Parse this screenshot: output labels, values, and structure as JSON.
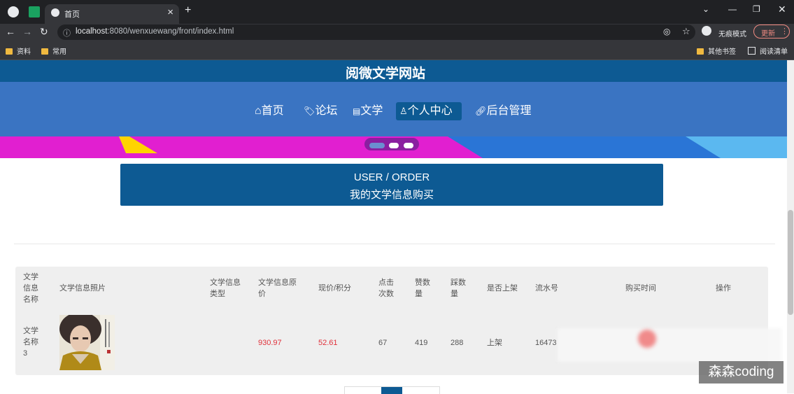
{
  "browser": {
    "tab_title": "首页",
    "url_host": "localhost",
    "url_rest": ":8080/wenxuewang/front/index.html",
    "incognito_label": "无痕模式",
    "update_label": "更新",
    "bookmarks": [
      "资料",
      "常用"
    ],
    "bookmarks_right": [
      "其他书签",
      "阅读清单"
    ]
  },
  "site": {
    "title": "阅微文学网站",
    "nav": [
      {
        "icon": "home-icon",
        "label": "首页"
      },
      {
        "icon": "tag-icon",
        "label": "论坛"
      },
      {
        "icon": "book-icon",
        "label": "文学"
      },
      {
        "icon": "user-icon",
        "label": "个人中心",
        "active": true
      },
      {
        "icon": "link-icon",
        "label": "后台管理"
      }
    ]
  },
  "section": {
    "title_en": "USER / ORDER",
    "title_cn": "我的文学信息购买"
  },
  "table": {
    "headers": [
      "文学信息名称",
      "文学信息照片",
      "文学信息类型",
      "文学信息原价",
      "现价/积分",
      "点击次数",
      "赞数量",
      "踩数量",
      "是否上架",
      "流水号",
      "购买时间",
      "操作"
    ],
    "rows": [
      {
        "name": "文学名称3",
        "original_price": "930.97",
        "price": "52.61",
        "clicks": "67",
        "likes": "419",
        "dislikes": "288",
        "on_shelf": "上架",
        "serial": "16473"
      }
    ]
  },
  "watermark": "森森coding",
  "colors": {
    "primary": "#0d5a93",
    "nav": "#3a74c2",
    "banner": "#e11fd0",
    "price": "#e0303a"
  }
}
